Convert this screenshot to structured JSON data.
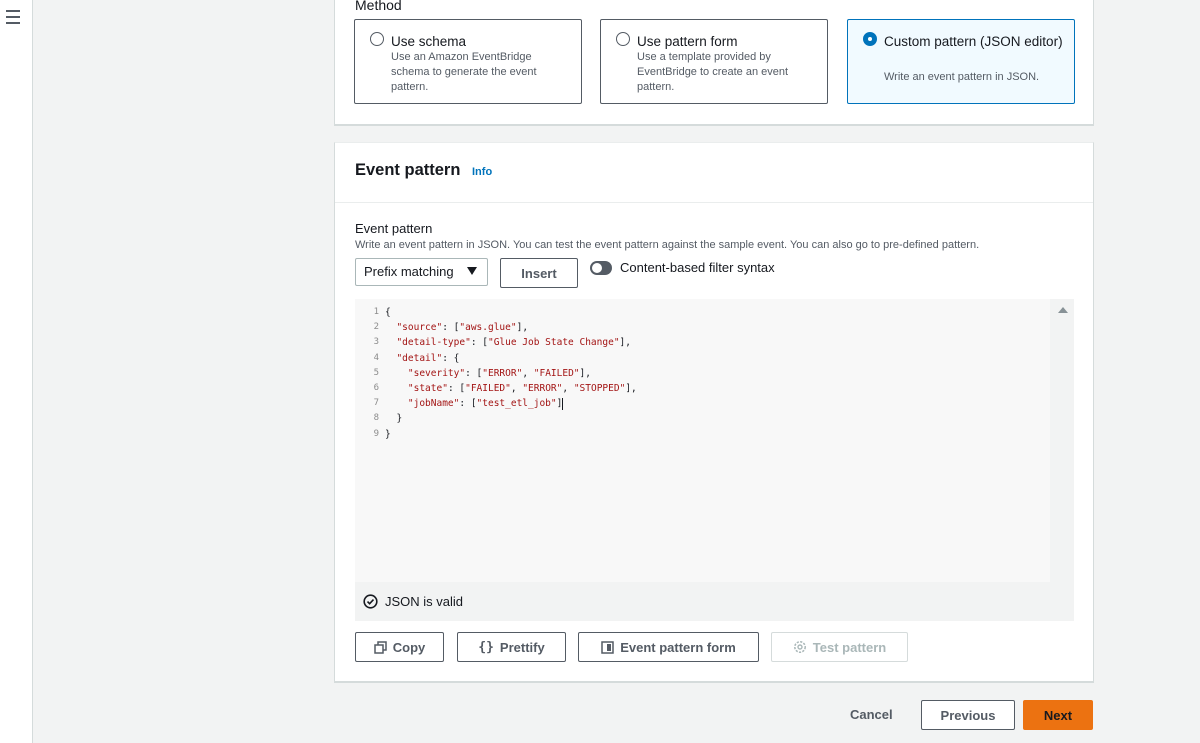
{
  "method": {
    "label": "Method",
    "options": [
      {
        "title": "Use schema",
        "desc": "Use an Amazon EventBridge schema to generate the event pattern.",
        "selected": false
      },
      {
        "title": "Use pattern form",
        "desc": "Use a template provided by EventBridge to create an event pattern.",
        "selected": false
      },
      {
        "title": "Custom pattern (JSON editor)",
        "desc": "Write an event pattern in JSON.",
        "selected": true
      }
    ]
  },
  "event_pattern_section": {
    "title": "Event pattern",
    "info": "Info",
    "field_label": "Event pattern",
    "field_desc": "Write an event pattern in JSON. You can test the event pattern against the sample event. You can also go to pre-defined pattern.",
    "select_value": "Prefix matching",
    "insert_button": "Insert",
    "toggle_label": "Content-based filter syntax",
    "toggle_on": false
  },
  "editor": {
    "line_numbers": [
      "1",
      "2",
      "3",
      "4",
      "5",
      "6",
      "7",
      "8",
      "9"
    ],
    "lines": [
      "{",
      "  \"source\": [\"aws.glue\"],",
      "  \"detail-type\": [\"Glue Job State Change\"],",
      "  \"detail\": {",
      "    \"severity\": [\"ERROR\", \"FAILED\"],",
      "    \"state\": [\"FAILED\", \"ERROR\", \"STOPPED\"],",
      "    \"jobName\": [\"test_etl_job\"]",
      "  }",
      "}"
    ],
    "validation": "JSON is valid"
  },
  "actions": {
    "copy": "Copy",
    "prettify": "Prettify",
    "event_pattern_form": "Event pattern form",
    "test_pattern": "Test pattern"
  },
  "footer": {
    "cancel": "Cancel",
    "previous": "Previous",
    "next": "Next"
  },
  "colors": {
    "accent": "#0073bb",
    "primary_button": "#ec7211",
    "string": "#a31515"
  }
}
